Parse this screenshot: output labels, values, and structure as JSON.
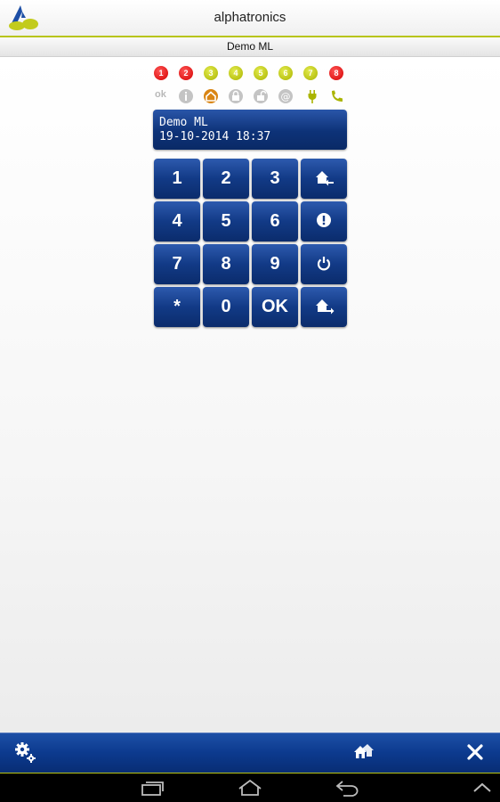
{
  "header": {
    "title": "alphatronics",
    "logo_icon": "alphatronics-logo-icon"
  },
  "subheader": {
    "title": "Demo ML"
  },
  "zones": [
    {
      "label": "1",
      "color": "red"
    },
    {
      "label": "2",
      "color": "red"
    },
    {
      "label": "3",
      "color": "green"
    },
    {
      "label": "4",
      "color": "green"
    },
    {
      "label": "5",
      "color": "green"
    },
    {
      "label": "6",
      "color": "green"
    },
    {
      "label": "7",
      "color": "green"
    },
    {
      "label": "8",
      "color": "red"
    }
  ],
  "status": {
    "ok_label": "ok",
    "icons": [
      "info-icon",
      "home-icon",
      "lock-icon",
      "unlock-icon",
      "at-icon",
      "power-plug-icon",
      "phone-icon"
    ]
  },
  "display": {
    "line1": "Demo ML",
    "line2": "19-10-2014 18:37"
  },
  "keypad": {
    "row1": [
      "1",
      "2",
      "3"
    ],
    "row2": [
      "4",
      "5",
      "6"
    ],
    "row3": [
      "7",
      "8",
      "9"
    ],
    "row4": [
      "*",
      "0",
      "OK"
    ],
    "function_icons": [
      "home-in-icon",
      "alert-icon",
      "power-icon",
      "home-out-icon"
    ]
  },
  "bottombar": {
    "icons": [
      "settings-icon",
      "home-icon",
      "close-icon"
    ]
  },
  "navbar": {
    "icons": [
      "recent-apps-icon",
      "home-nav-icon",
      "back-icon",
      "up-chevron-icon"
    ]
  },
  "colors": {
    "accent": "#b8c417",
    "key_blue": "#123a86",
    "zone_red": "#d40000",
    "zone_green": "#aab400",
    "status_orange": "#d98514"
  }
}
